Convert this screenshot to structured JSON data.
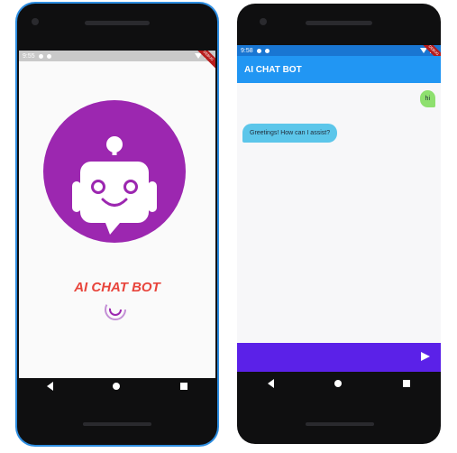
{
  "left_phone": {
    "status_time": "9:55",
    "debug_banner": "DEBUG",
    "app_title": "AI CHAT BOT",
    "colors": {
      "logo_circle": "#9c27b0",
      "title": "#e8453c",
      "spinner": "#9c27b0"
    },
    "icons": {
      "logo": "robot-icon",
      "loader": "spinner-icon"
    }
  },
  "right_phone": {
    "status_time": "9:58",
    "debug_banner": "DEBUG",
    "app_bar_title": "AI CHAT BOT",
    "messages": [
      {
        "sender": "user",
        "text": "hi"
      },
      {
        "sender": "bot",
        "text": "Greetings! How can I assist?"
      }
    ],
    "input": {
      "value": "",
      "placeholder": ""
    },
    "colors": {
      "app_bar": "#2196f3",
      "user_bubble": "#8ee06f",
      "bot_bubble": "#5cc6ea",
      "input_bar": "#5b21e8"
    },
    "icons": {
      "send": "send-icon"
    }
  }
}
